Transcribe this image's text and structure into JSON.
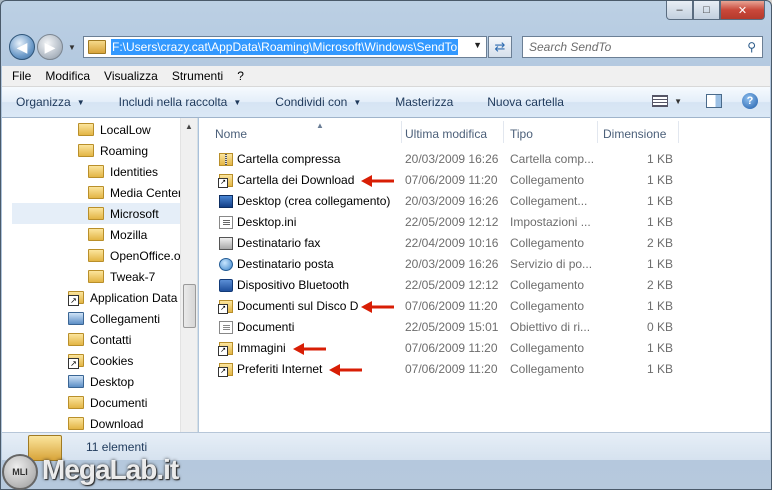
{
  "window": {
    "caption_buttons": {
      "minimize": "–",
      "maximize": "□",
      "close": "✕"
    }
  },
  "address": {
    "path": "F:\\Users\\crazy.cat\\AppData\\Roaming\\Microsoft\\Windows\\SendTo",
    "search_placeholder": "Search SendTo"
  },
  "menu": {
    "items": [
      "File",
      "Modifica",
      "Visualizza",
      "Strumenti",
      "?"
    ]
  },
  "toolbar": {
    "organizza": "Organizza",
    "includi": "Includi nella raccolta",
    "condividi": "Condividi con",
    "masterizza": "Masterizza",
    "nuova_cartella": "Nuova cartella"
  },
  "navpane": {
    "items": [
      {
        "label": "LocalLow",
        "icon": "folder"
      },
      {
        "label": "Roaming",
        "icon": "folder"
      },
      {
        "label": "Identities",
        "icon": "folder"
      },
      {
        "label": "Media Center",
        "icon": "folder"
      },
      {
        "label": "Microsoft",
        "icon": "folder",
        "selected": true
      },
      {
        "label": "Mozilla",
        "icon": "folder"
      },
      {
        "label": "OpenOffice.o",
        "icon": "folder"
      },
      {
        "label": "Tweak-7",
        "icon": "folder"
      },
      {
        "label": "Application Data",
        "icon": "folder-shortcut"
      },
      {
        "label": "Collegamenti",
        "icon": "folder-blue"
      },
      {
        "label": "Contatti",
        "icon": "folder"
      },
      {
        "label": "Cookies",
        "icon": "folder-shortcut"
      },
      {
        "label": "Desktop",
        "icon": "folder-blue"
      },
      {
        "label": "Documenti",
        "icon": "folder"
      },
      {
        "label": "Download",
        "icon": "folder"
      }
    ]
  },
  "filelist": {
    "columns": {
      "name": "Nome",
      "modified": "Ultima modifica",
      "type": "Tipo",
      "size": "Dimensione"
    },
    "rows": [
      {
        "name": "Cartella compressa",
        "date": "20/03/2009 16:26",
        "type": "Cartella comp...",
        "size": "1 KB",
        "icon": "zip-folder-icon",
        "arrow": false
      },
      {
        "name": "Cartella dei Download",
        "date": "07/06/2009 11:20",
        "type": "Collegamento",
        "size": "1 KB",
        "icon": "shortcut-icon",
        "arrow": true
      },
      {
        "name": "Desktop (crea collegamento)",
        "date": "20/03/2009 16:26",
        "type": "Collegament...",
        "size": "1 KB",
        "icon": "desktop-icon",
        "arrow": false
      },
      {
        "name": "Desktop.ini",
        "date": "22/05/2009 12:12",
        "type": "Impostazioni ...",
        "size": "1 KB",
        "icon": "ini-file-icon",
        "arrow": false
      },
      {
        "name": "Destinatario fax",
        "date": "22/04/2009 10:16",
        "type": "Collegamento",
        "size": "2 KB",
        "icon": "fax-icon",
        "arrow": false
      },
      {
        "name": "Destinatario posta",
        "date": "20/03/2009 16:26",
        "type": "Servizio di po...",
        "size": "1 KB",
        "icon": "mail-icon",
        "arrow": false
      },
      {
        "name": "Dispositivo Bluetooth",
        "date": "22/05/2009 12:12",
        "type": "Collegamento",
        "size": "2 KB",
        "icon": "bluetooth-icon",
        "arrow": false
      },
      {
        "name": "Documenti sul Disco D",
        "date": "07/06/2009 11:20",
        "type": "Collegamento",
        "size": "1 KB",
        "icon": "shortcut-icon",
        "arrow": true
      },
      {
        "name": "Documenti",
        "date": "22/05/2009 15:01",
        "type": "Obiettivo di ri...",
        "size": "0 KB",
        "icon": "document-icon",
        "arrow": false
      },
      {
        "name": "Immagini",
        "date": "07/06/2009 11:20",
        "type": "Collegamento",
        "size": "1 KB",
        "icon": "shortcut-icon",
        "arrow": true
      },
      {
        "name": "Preferiti Internet",
        "date": "07/06/2009 11:20",
        "type": "Collegamento",
        "size": "1 KB",
        "icon": "shortcut-icon",
        "arrow": true
      }
    ]
  },
  "status": {
    "count": "11 elementi"
  },
  "watermark": {
    "text": "MegaLab.it",
    "badge": "MLI"
  },
  "colors": {
    "annotation_arrow": "#d81e05",
    "selection": "#3399ff"
  }
}
